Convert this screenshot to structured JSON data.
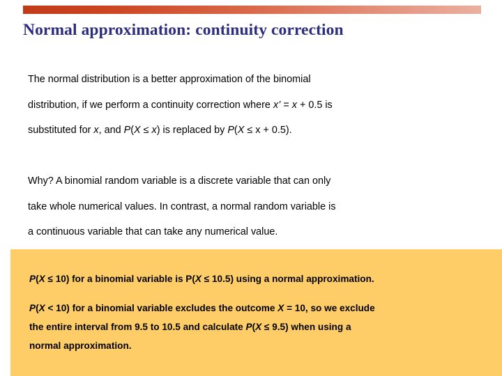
{
  "slide": {
    "title": "Normal approximation: continuity correction",
    "title_color": "#2d2d7e",
    "background_color": "#ffffff"
  },
  "decor": {
    "top_bar_gradient_start": "#c33a18",
    "top_bar_gradient_end": "#eab09f"
  },
  "body": {
    "paragraph_1": {
      "line_1": "The normal distribution is a better approximation of the binomial",
      "line_2_a": "distribution, if we perform a continuity correction where ",
      "line_2_var": "x’",
      "line_2_b": " = ",
      "line_2_var2": "x",
      "line_2_c": " + 0.5 is",
      "line_3_a": "substituted for ",
      "line_3_var": "x",
      "line_3_b": ", and ",
      "line_3_expr1": "P",
      "line_3_b2": "(",
      "line_3_var2": "X",
      "line_3_b3": " ≤ ",
      "line_3_var3": "x",
      "line_3_b4": ") is replaced by ",
      "line_3_expr2": "P",
      "line_3_b5": "(",
      "line_3_var4": "X",
      "line_3_b6": " ≤ x + 0.5)."
    },
    "paragraph_2": {
      "line_1": "Why? A binomial random variable is a discrete variable that can only",
      "line_2": "take whole numerical values. In contrast, a normal random variable is",
      "line_3": "a continuous variable that can take any numerical value."
    }
  },
  "callout": {
    "background_color": "#ffcd68",
    "paragraph_1": {
      "p_italic_1": "P",
      "t1": "(",
      "var_1": "X",
      "t2": " ≤ 10) for a binomial variable is P(",
      "var_2": "X",
      "t3": " ≤ 10.5) using a normal approximation."
    },
    "paragraph_2": {
      "p_italic_1": "P",
      "t1": "(",
      "var_1": "X",
      "t2": " < 10) for a binomial variable excludes the outcome ",
      "var_2": "X",
      "t3": " = 10, so we exclude",
      "line_2_a": "the entire interval from 9.5 to 10.5 and calculate ",
      "line_2_p": "P",
      "line_2_b": "(",
      "line_2_var": "X",
      "line_2_c": " ≤ 9.5) when using a",
      "line_3": "normal approximation."
    }
  }
}
